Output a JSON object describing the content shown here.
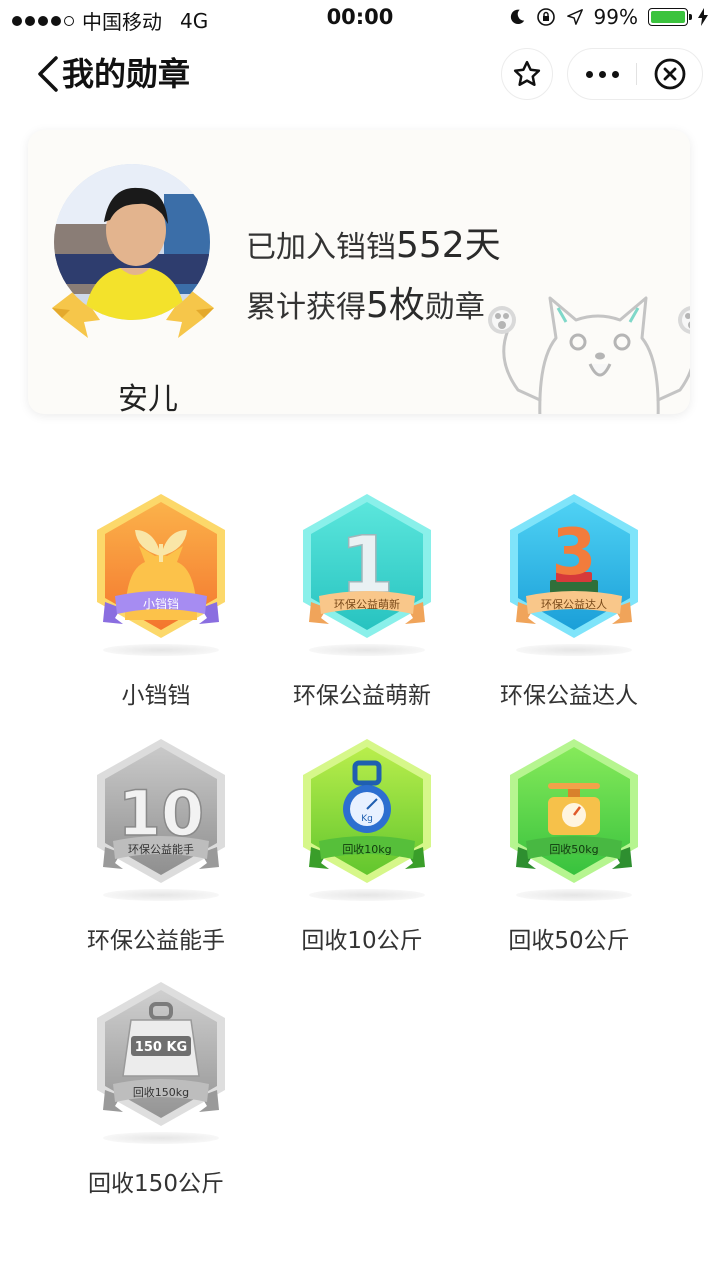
{
  "status_bar": {
    "carrier": "中国移动",
    "network": "4G",
    "time": "00:00",
    "battery": "99%",
    "battery_level": 0.99
  },
  "nav": {
    "title": "我的勋章"
  },
  "profile": {
    "name": "安儿",
    "stat1_prefix": "已加入铛铛",
    "stat1_value": "552天",
    "stat2_prefix": "累计获得",
    "stat2_value": "5枚",
    "stat2_suffix": "勋章"
  },
  "badges": [
    {
      "name": "小铛铛",
      "ribbon": "小铛铛",
      "earned": true,
      "color": "#f79a3a"
    },
    {
      "name": "环保公益萌新",
      "ribbon": "环保公益萌新",
      "earned": true,
      "color": "#3fd4cf"
    },
    {
      "name": "环保公益达人",
      "ribbon": "环保公益达人",
      "earned": true,
      "color": "#2ab4e0"
    },
    {
      "name": "环保公益能手",
      "ribbon": "环保公益能手",
      "earned": false,
      "color": "#a9a9a9"
    },
    {
      "name": "回收10公斤",
      "ribbon": "回收10kg",
      "earned": true,
      "color": "#7ed43a"
    },
    {
      "name": "回收50公斤",
      "ribbon": "回收50kg",
      "earned": true,
      "color": "#5bd14a"
    },
    {
      "name": "回收150公斤",
      "ribbon": "回收150kg",
      "earned": false,
      "color": "#a9a9a9",
      "weight_label": "150 KG"
    }
  ],
  "badge_art_text": {
    "b2": "1",
    "b3": "3",
    "b4": "10",
    "b5": "Kg"
  }
}
